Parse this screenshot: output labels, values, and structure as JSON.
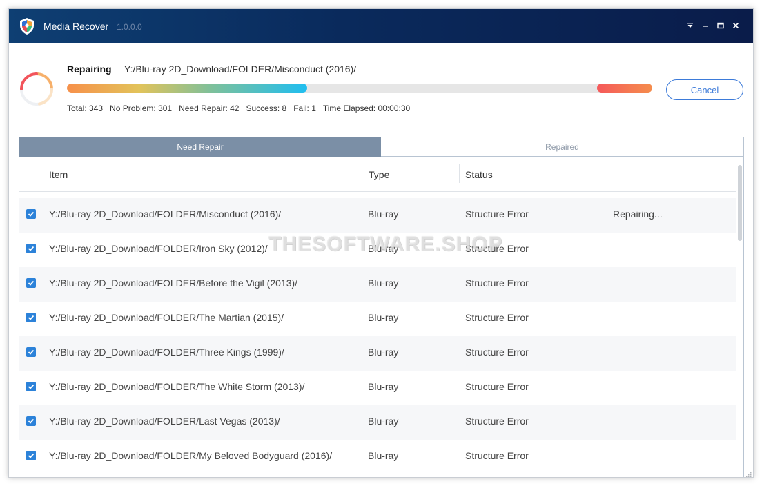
{
  "window": {
    "title": "Media Recover",
    "version": "1.0.0.0",
    "icons": {
      "logo": "shield-logo-icon",
      "menu": "dropdown-menu-icon",
      "minimize": "minimize-icon",
      "maximize": "maximize-icon",
      "close": "close-icon"
    }
  },
  "status": {
    "label": "Repairing",
    "current_path": "Y:/Blu-ray 2D_Download/FOLDER/Misconduct (2016)/",
    "progress_fraction": 0.41,
    "stats": {
      "total": "Total: 343",
      "no_problem": "No Problem: 301",
      "need_repair": "Need Repair: 42",
      "success": "Success: 8",
      "fail": "Fail: 1",
      "time_elapsed": "Time Elapsed: 00:00:30"
    },
    "cancel_label": "Cancel"
  },
  "tabs": [
    {
      "label": "Need Repair",
      "active": true
    },
    {
      "label": "Repaired",
      "active": false
    }
  ],
  "table": {
    "headers": {
      "item": "Item",
      "type": "Type",
      "status": "Status"
    },
    "rows": [
      {
        "checked": true,
        "item": "Y:/Blu-ray 2D_Download/FOLDER/Misconduct (2016)/",
        "type": "Blu-ray",
        "status": "Structure Error",
        "progress": "Repairing..."
      },
      {
        "checked": true,
        "item": "Y:/Blu-ray 2D_Download/FOLDER/Iron Sky (2012)/",
        "type": "Blu-ray",
        "status": "Structure Error",
        "progress": ""
      },
      {
        "checked": true,
        "item": "Y:/Blu-ray 2D_Download/FOLDER/Before the Vigil (2013)/",
        "type": "Blu-ray",
        "status": "Structure Error",
        "progress": ""
      },
      {
        "checked": true,
        "item": "Y:/Blu-ray 2D_Download/FOLDER/The Martian (2015)/",
        "type": "Blu-ray",
        "status": "Structure Error",
        "progress": ""
      },
      {
        "checked": true,
        "item": "Y:/Blu-ray 2D_Download/FOLDER/Three Kings (1999)/",
        "type": "Blu-ray",
        "status": "Structure Error",
        "progress": ""
      },
      {
        "checked": true,
        "item": "Y:/Blu-ray 2D_Download/FOLDER/The White Storm (2013)/",
        "type": "Blu-ray",
        "status": "Structure Error",
        "progress": ""
      },
      {
        "checked": true,
        "item": "Y:/Blu-ray 2D_Download/FOLDER/Last Vegas (2013)/",
        "type": "Blu-ray",
        "status": "Structure Error",
        "progress": ""
      },
      {
        "checked": true,
        "item": "Y:/Blu-ray 2D_Download/FOLDER/My Beloved Bodyguard (2016)/",
        "type": "Blu-ray",
        "status": "Structure Error",
        "progress": ""
      }
    ]
  },
  "watermark": "THESOFTWARE.SHOP",
  "colors": {
    "titlebar": "#0a2a5c",
    "accent": "#3d7bd9",
    "checkbox": "#2c82d9",
    "active_tab": "#7b8fa6"
  }
}
